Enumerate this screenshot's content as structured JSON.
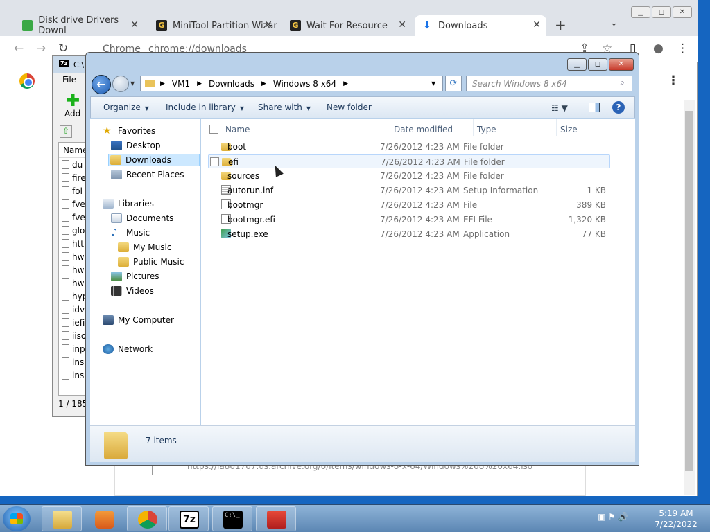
{
  "chrome": {
    "tabs": [
      {
        "title": "Disk drive Drivers Downl",
        "color": "#3aa845"
      },
      {
        "title": "MiniTool Partition Wizar",
        "color": "#333333"
      },
      {
        "title": "Wait For Resource",
        "color": "#333333"
      },
      {
        "title": "Downloads",
        "color": "#1a73e8"
      }
    ],
    "tab_close": "✕",
    "new_tab": "+",
    "tab_dropdown": "⌄",
    "win_buttons": [
      "▁",
      "◻",
      "✕"
    ],
    "omnibox_brand": "Chrome",
    "omnibox_url": "chrome://downloads",
    "download_url": "https://ia801707.us.archive.org/0/items/windows-8-x-64/Windows%208%20x64.iso",
    "nav_icons": {
      "back": "←",
      "forward": "→",
      "reload": "↻",
      "share": "⇪",
      "star": "☆",
      "sidepanel": "▯",
      "profile": "●",
      "menu": "⋮"
    }
  },
  "sevenzip": {
    "title_prefix": "C:\\",
    "menu_file": "File",
    "add_label": "Add",
    "list_header": "Name",
    "rows": [
      "du",
      "fire",
      "fol",
      "fve",
      "fve",
      "glo",
      "htt",
      "hw",
      "hw",
      "hw",
      "hyp",
      "idv",
      "iefi",
      "iiso",
      "inp",
      "ins",
      "ins"
    ],
    "status": "1 / 185"
  },
  "explorer": {
    "address": [
      "VM1",
      "Downloads",
      "Windows 8 x64"
    ],
    "search_placeholder": "Search Windows 8 x64",
    "commands": {
      "organize": "Organize",
      "include_in_library": "Include in library",
      "share_with": "Share with",
      "new_folder": "New folder"
    },
    "nav": {
      "favorites": "Favorites",
      "desktop": "Desktop",
      "downloads": "Downloads",
      "recent_places": "Recent Places",
      "libraries": "Libraries",
      "documents": "Documents",
      "music": "Music",
      "my_music": "My Music",
      "public_music": "Public Music",
      "pictures": "Pictures",
      "videos": "Videos",
      "my_computer": "My Computer",
      "network": "Network"
    },
    "columns": {
      "name": "Name",
      "date_modified": "Date modified",
      "type": "Type",
      "size": "Size"
    },
    "files": [
      {
        "name": "boot",
        "date": "7/26/2012 4:23 AM",
        "type": "File folder",
        "size": "",
        "icon": "folder-icon"
      },
      {
        "name": "efi",
        "date": "7/26/2012 4:23 AM",
        "type": "File folder",
        "size": "",
        "icon": "folder-icon"
      },
      {
        "name": "sources",
        "date": "7/26/2012 4:23 AM",
        "type": "File folder",
        "size": "",
        "icon": "folder-icon"
      },
      {
        "name": "autorun.inf",
        "date": "7/26/2012 4:23 AM",
        "type": "Setup Information",
        "size": "1 KB",
        "icon": "settings-file-icon"
      },
      {
        "name": "bootmgr",
        "date": "7/26/2012 4:23 AM",
        "type": "File",
        "size": "389 KB",
        "icon": "file-icon"
      },
      {
        "name": "bootmgr.efi",
        "date": "7/26/2012 4:23 AM",
        "type": "EFI File",
        "size": "1,320 KB",
        "icon": "file-icon"
      },
      {
        "name": "setup.exe",
        "date": "7/26/2012 4:23 AM",
        "type": "Application",
        "size": "77 KB",
        "icon": "setup-exe-icon"
      }
    ],
    "item_count": "7 items"
  },
  "taskbar": {
    "apps": [
      "explorer-icon",
      "media-player-icon",
      "chrome-icon",
      "7zip-icon",
      "cmd-icon",
      "toolbox-icon"
    ],
    "sevenzip_label": "7z",
    "cmd_label": "C:\\_",
    "tray_icons": "▣ ⚑ 🔊",
    "time": "5:19 AM",
    "date": "7/22/2022"
  }
}
